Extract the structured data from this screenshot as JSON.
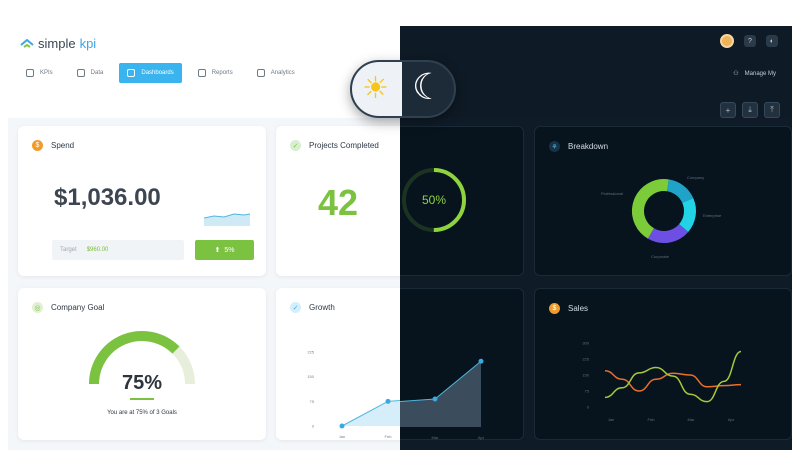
{
  "app": {
    "logo_simple": "simple",
    "logo_kpi": "kpi",
    "nav": [
      {
        "label": "KPIs",
        "icon": "kpi-icon"
      },
      {
        "label": "Data",
        "icon": "data-icon"
      },
      {
        "label": "Dashboards",
        "icon": "dashboards-icon",
        "active": true
      },
      {
        "label": "Reports",
        "icon": "reports-icon"
      },
      {
        "label": "Analytics",
        "icon": "analytics-icon"
      }
    ],
    "manage_label": "Manage My",
    "help_label": "?",
    "theme_label": "◐"
  },
  "spend": {
    "title": "Spend",
    "value": "$1,036.00",
    "target_label": "Target",
    "target_value": "$960.00",
    "change": "5%"
  },
  "projects": {
    "title": "Projects Completed",
    "value": "42",
    "percent": "50%",
    "percent_value": 0.5
  },
  "breakdown": {
    "title": "Breakdown",
    "labels": [
      "Company",
      "Professional",
      "Enterprise",
      "Corporate"
    ],
    "slices": [
      {
        "name": "Company",
        "value": 0.16,
        "color": "#1fa3c9"
      },
      {
        "name": "Enterprise",
        "value": 0.18,
        "color": "#22d3e6"
      },
      {
        "name": "Corporate",
        "value": 0.22,
        "color": "#6d4fe3"
      },
      {
        "name": "Professional",
        "value": 0.44,
        "color": "#7ccc3a"
      }
    ]
  },
  "goal": {
    "title": "Company Goal",
    "value": "75%",
    "level": 0.75,
    "caption": "You are at 75% of 3 Goals"
  },
  "growth": {
    "title": "Growth"
  },
  "sales": {
    "title": "Sales"
  },
  "chart_data": [
    {
      "type": "area",
      "categories": [
        "Jan",
        "Feb",
        "Mar",
        "Apr"
      ],
      "values": [
        0,
        75,
        85,
        200
      ],
      "yticks": [
        0,
        75,
        150,
        225
      ],
      "ylim": [
        0,
        225
      ]
    },
    {
      "type": "line",
      "x": [
        0,
        1,
        2,
        3,
        4,
        5,
        6,
        7,
        8
      ],
      "series": [
        {
          "color": "#e8702a",
          "values": [
            170,
            130,
            75,
            130,
            158,
            150,
            95,
            100,
            105
          ]
        },
        {
          "color": "#a8c83a",
          "values": [
            45,
            90,
            160,
            185,
            145,
            60,
            25,
            120,
            260
          ]
        }
      ],
      "ylim": [
        0,
        300
      ],
      "yticks": [
        0,
        75,
        150,
        225,
        300
      ],
      "categories": [
        "Jan",
        "Feb",
        "Mar",
        "Apr"
      ]
    }
  ],
  "toggle": {
    "sun": "☀",
    "moon": "☾"
  }
}
